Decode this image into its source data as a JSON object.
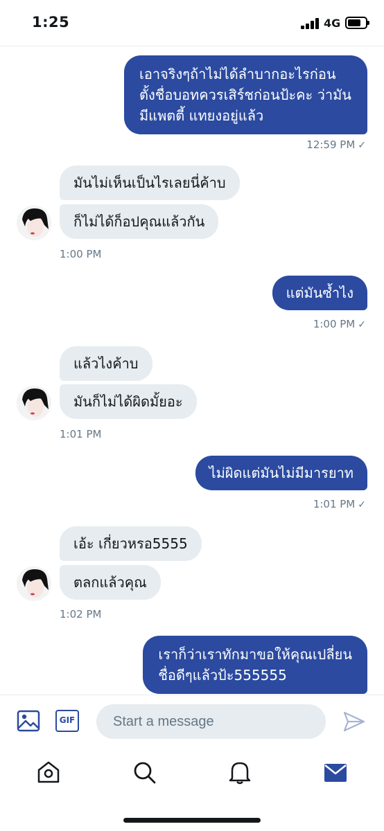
{
  "status_bar": {
    "time": "1:25",
    "network": "4G",
    "battery_level": 0.75
  },
  "conversation": {
    "messages": [
      {
        "direction": "outgoing",
        "lines": [
          "เอาจริงๆถ้าไม่ได้ลำบากอะไรก่อน",
          "ตั้งชื่อบอทควรเสิร์ชก่อนป้ะคะ ว่ามัน",
          "มีแพตตี้ แทยงอยู่แล้ว"
        ],
        "time": "12:59 PM"
      },
      {
        "direction": "incoming",
        "text": "มันไม่เห็นเป็นไรเลยนี่ค้าบ"
      },
      {
        "direction": "incoming",
        "text": "ก็ไม่ได้ก็อปคุณแล้วกัน",
        "time": "1:00 PM"
      },
      {
        "direction": "outgoing",
        "text": "แต่มันซ้ำไง",
        "time": "1:00 PM"
      },
      {
        "direction": "incoming",
        "text": "แล้วไงค้าบ"
      },
      {
        "direction": "incoming",
        "text": "มันก็ไม่ได้ผิดมั้ยอะ",
        "time": "1:01 PM"
      },
      {
        "direction": "outgoing",
        "text": "ไม่ผิดแต่มันไม่มีมารยาท",
        "time": "1:01 PM"
      },
      {
        "direction": "incoming",
        "text": "เอ้ะ เกี่ยวหรอ5555"
      },
      {
        "direction": "incoming",
        "text": "ตลกแล้วคุณ",
        "time": "1:02 PM"
      },
      {
        "direction": "outgoing",
        "lines": [
          "เราก็ว่าเราทักมาขอให้คุณเปลี่ยน",
          "ชื่อดีๆแล้วป้ะ555555"
        ]
      }
    ],
    "read_check": "✓"
  },
  "composer": {
    "image_icon": "image-icon",
    "gif_label": "GIF",
    "placeholder": "Start a message",
    "send_icon": "send-icon"
  },
  "tab_bar": {
    "items": [
      "home-icon",
      "search-icon",
      "bell-icon",
      "mail-icon"
    ],
    "active": "mail-icon"
  },
  "colors": {
    "accent": "#2b4aa0",
    "incoming_bubble": "#e6ecf0",
    "muted_text": "#657786"
  }
}
